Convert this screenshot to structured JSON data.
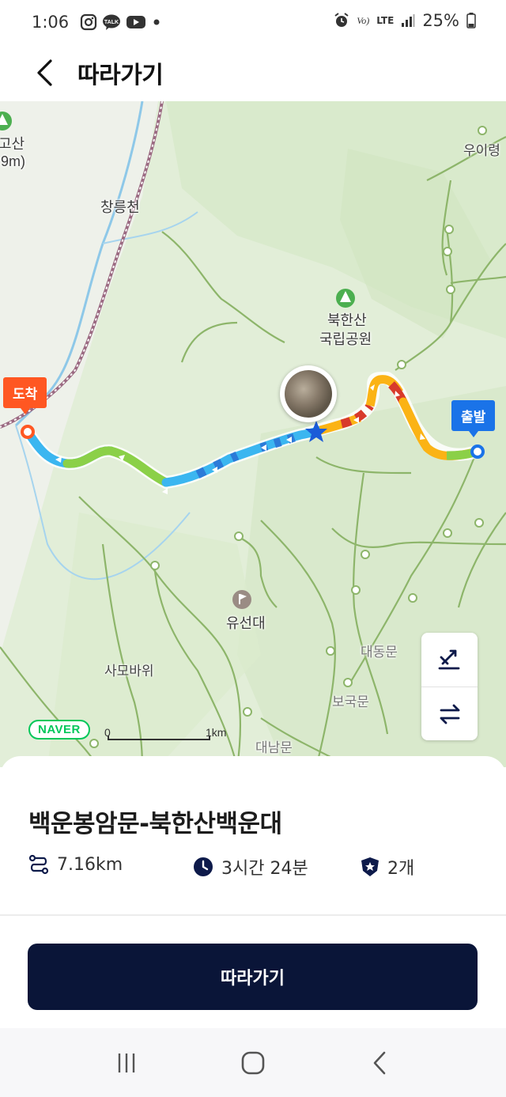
{
  "status_bar": {
    "time": "1:06",
    "left_icons": [
      "instagram-icon",
      "kakaotalk-icon",
      "youtube-icon",
      "dot-icon"
    ],
    "talk_label": "TALK",
    "right_icons": [
      "alarm-icon",
      "volte-icon",
      "lte-icon",
      "signal-icon",
      "battery-icon"
    ],
    "volte_label": "Vo)",
    "lte_label": "LTE",
    "battery": "25%"
  },
  "header": {
    "back_icon": "back-arrow-icon",
    "title": "따라가기"
  },
  "map": {
    "labels": {
      "peak_left": "고산",
      "peak_left_elev": ".9m)",
      "stream": "창릉천",
      "uiryeong": "우이령",
      "park_line1": "북한산",
      "park_line2": "국립공원",
      "yuseondae": "유선대",
      "samobawi": "사모바위",
      "daedongmun": "대동문",
      "bogukmun": "보국문",
      "daenammun": "대남문"
    },
    "arrival_flag": "도착",
    "departure_flag": "출발",
    "naver_logo": "NAVER",
    "scale_zero": "0",
    "scale_km": "1km",
    "controls": [
      "trail-toggle-icon",
      "reverse-route-icon"
    ],
    "colors": {
      "route_fast": "#fbb315",
      "route_slow": "#d83a2b",
      "route_mid": "#8bd048",
      "route_blue": "#3bb6f0",
      "arrival": "#ff5722",
      "departure": "#1a73e8"
    }
  },
  "course": {
    "title": "백운봉암문-북한산백운대",
    "distance_icon": "route-icon",
    "distance": "7.16km",
    "duration_icon": "clock-icon",
    "duration": "3시간 24분",
    "badge_icon": "shield-star-icon",
    "badge_count": "2개"
  },
  "follow_button": "따라가기",
  "nav_bar": [
    "recent-apps-icon",
    "home-icon",
    "back-icon"
  ]
}
